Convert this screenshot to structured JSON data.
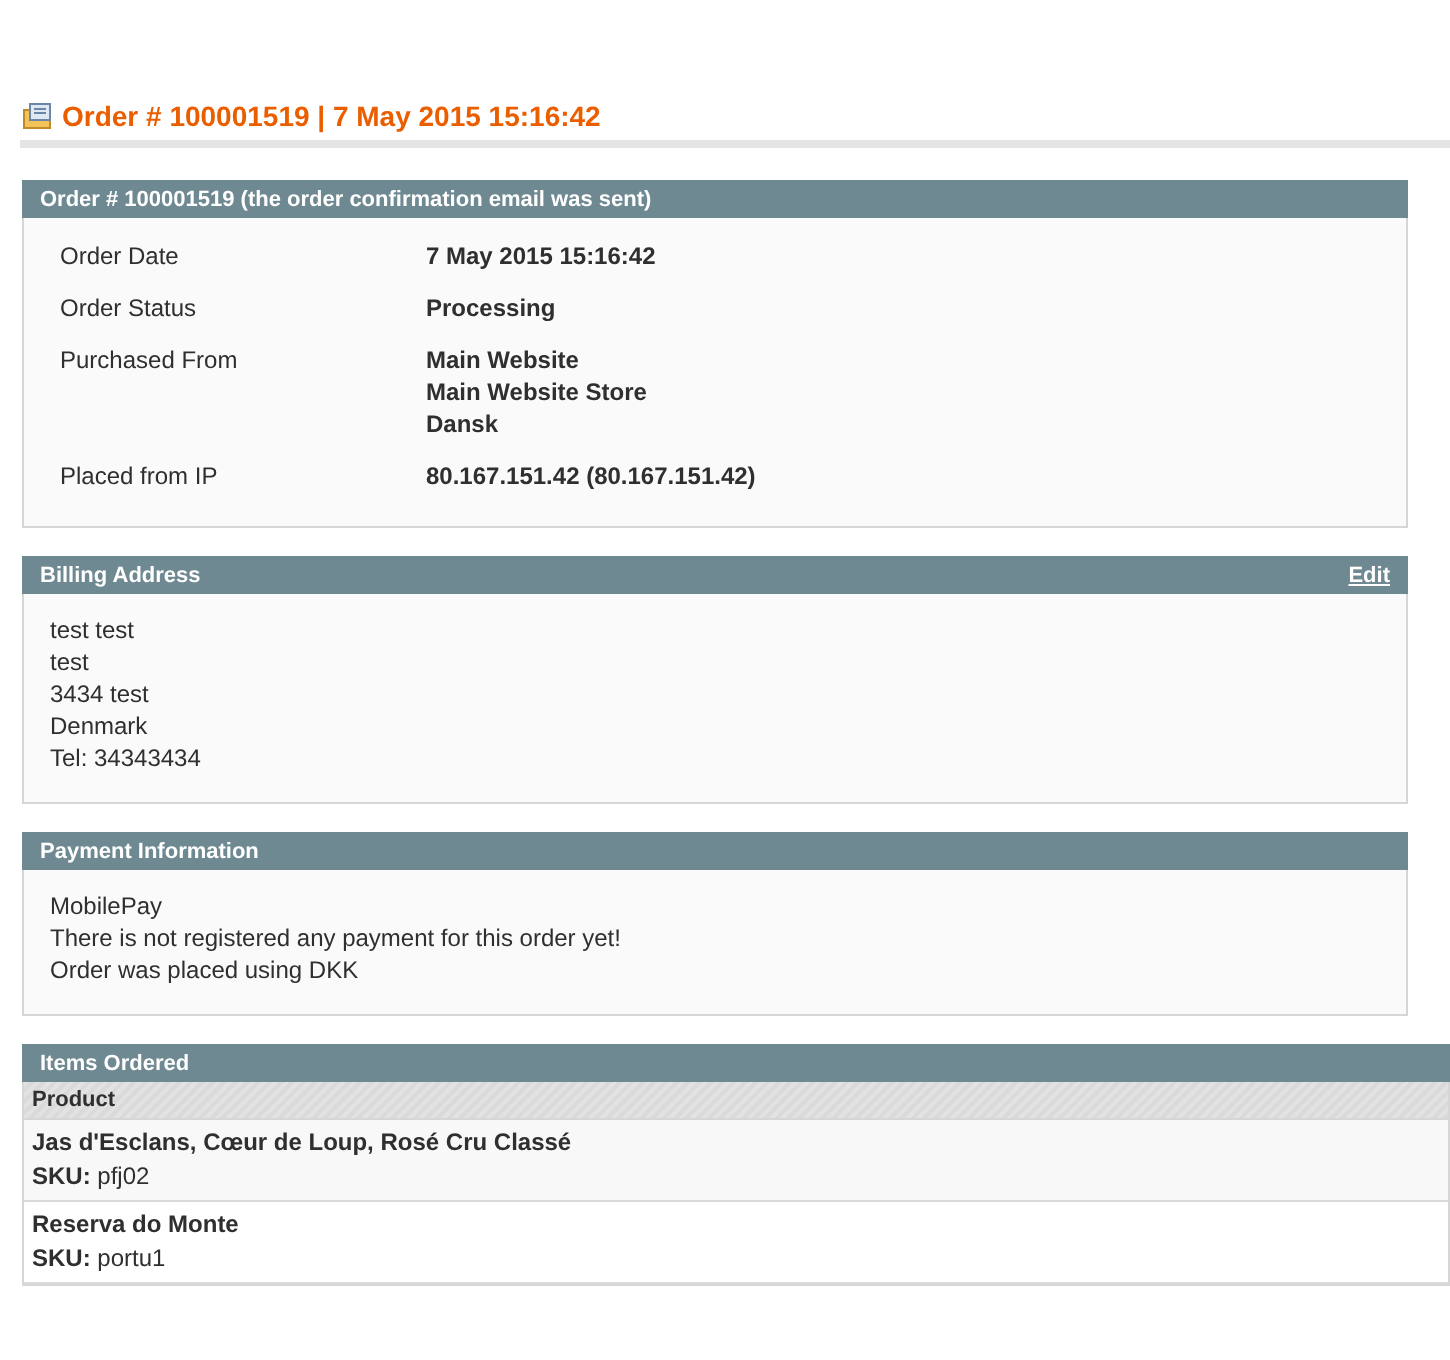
{
  "page_title": "Order # 100001519 | 7 May 2015 15:16:42",
  "order_box": {
    "title": "Order # 100001519 (the order confirmation email was sent)",
    "fields": [
      {
        "label": "Order Date",
        "values": [
          "7 May 2015 15:16:42"
        ]
      },
      {
        "label": "Order Status",
        "values": [
          "Processing"
        ]
      },
      {
        "label": "Purchased From",
        "values": [
          "Main Website",
          "Main Website Store",
          "Dansk"
        ]
      },
      {
        "label": "Placed from IP",
        "values": [
          "80.167.151.42 (80.167.151.42)"
        ]
      }
    ]
  },
  "billing_address": {
    "title": "Billing Address",
    "edit_link": "Edit",
    "lines": [
      "test test",
      "test",
      "3434 test",
      "Denmark",
      "Tel: 34343434"
    ]
  },
  "payment_information": {
    "title": "Payment Information",
    "lines": [
      "MobilePay",
      "There is not registered any payment for this order yet!",
      "Order was placed using DKK"
    ]
  },
  "items_ordered": {
    "title": "Items Ordered",
    "columns": [
      "Product"
    ],
    "rows": [
      {
        "name": "Jas d'Esclans, Cœur de Loup, Rosé Cru Classé",
        "sku": "**SKU:** pfj02"
      },
      {
        "name": "Reserva do Monte",
        "sku": "**SKU:** portu1"
      }
    ]
  }
}
